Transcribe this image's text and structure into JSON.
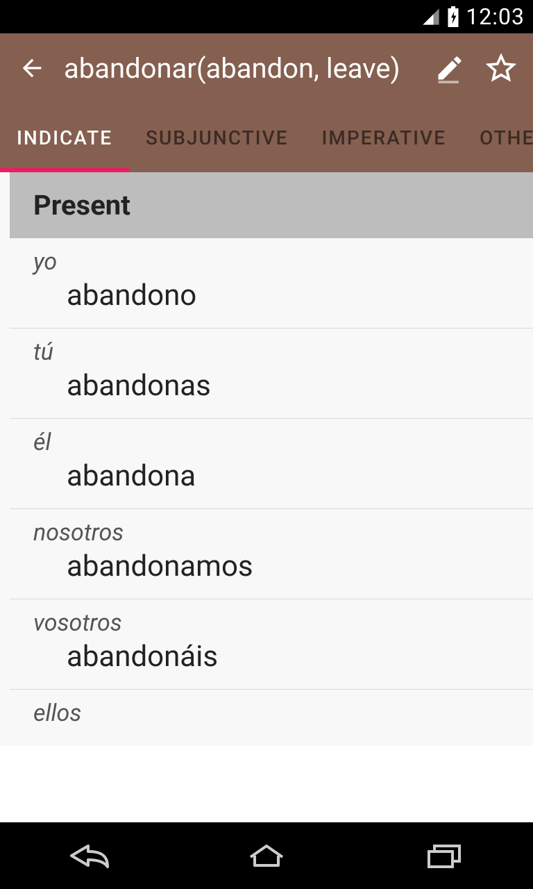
{
  "status": {
    "time": "12:03"
  },
  "appbar": {
    "title": "abandonar(abandon, leave)"
  },
  "tabs": {
    "items": [
      {
        "label": "INDICATE"
      },
      {
        "label": "SUBJUNCTIVE"
      },
      {
        "label": "IMPERATIVE"
      },
      {
        "label": "OTHER"
      }
    ],
    "active_index": 0
  },
  "section": {
    "title": "Present"
  },
  "conjugations": [
    {
      "pronoun": "yo",
      "form": "abandono"
    },
    {
      "pronoun": "tú",
      "form": "abandonas"
    },
    {
      "pronoun": "él",
      "form": "abandona"
    },
    {
      "pronoun": "nosotros",
      "form": "abandonamos"
    },
    {
      "pronoun": "vosotros",
      "form": "abandonáis"
    },
    {
      "pronoun": "ellos",
      "form": ""
    }
  ]
}
